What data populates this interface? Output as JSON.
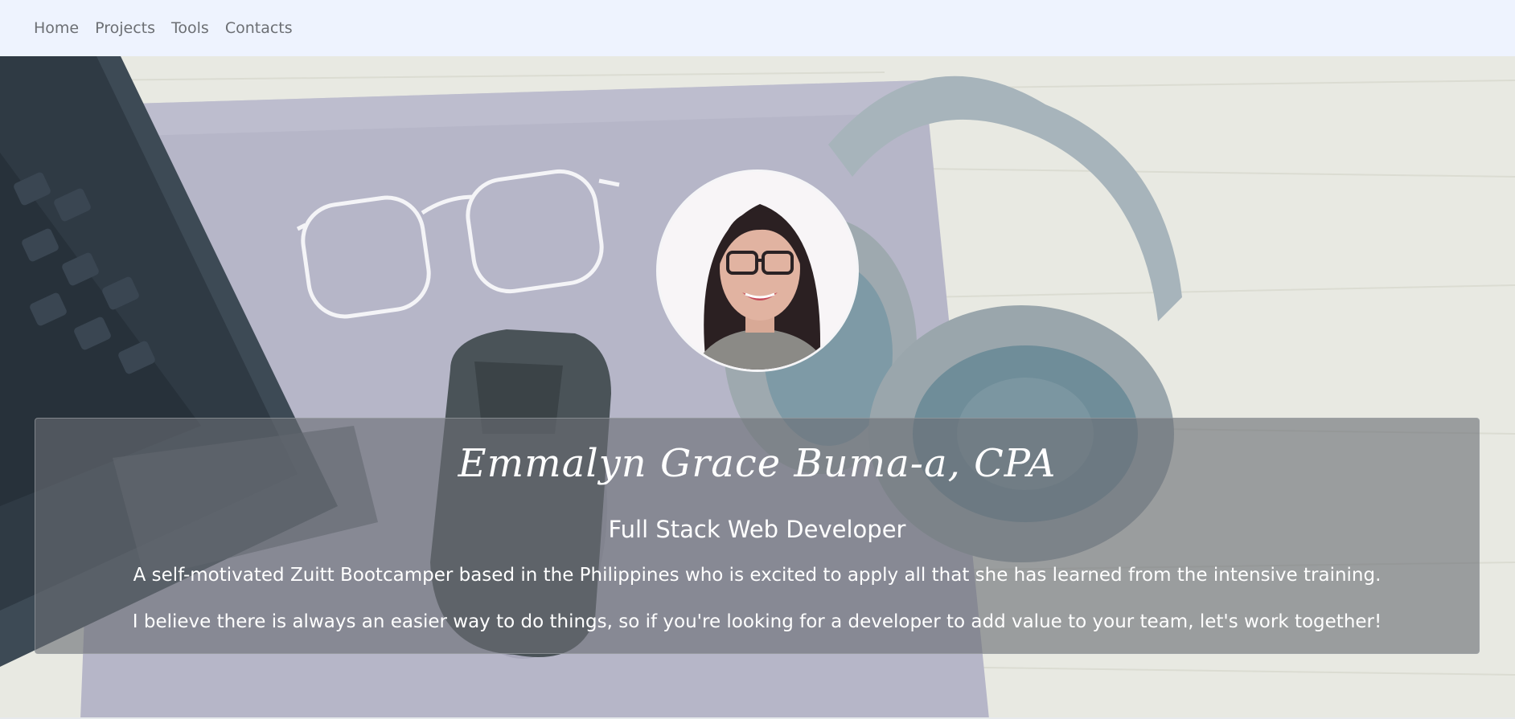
{
  "nav": {
    "items": [
      {
        "label": "Home"
      },
      {
        "label": "Projects"
      },
      {
        "label": "Tools"
      },
      {
        "label": "Contacts"
      }
    ]
  },
  "hero": {
    "name": "Emmalyn Grace Buma-a, CPA",
    "role": "Full Stack Web Developer",
    "description_1": "A self-motivated Zuitt Bootcamper based in the Philippines who is excited to apply all that she has learned from the intensive training.",
    "description_2": "I believe there is always an easier way to do things, so if you're looking for a developer to add value to your team, let's work together!"
  },
  "colors": {
    "navbar_bg": "#eef3fe",
    "nav_text": "#6c6f74",
    "card_bg": "rgba(106,110,116,0.62)",
    "mousepad": "#b4b4c6",
    "wood": "#e7e8e0"
  }
}
